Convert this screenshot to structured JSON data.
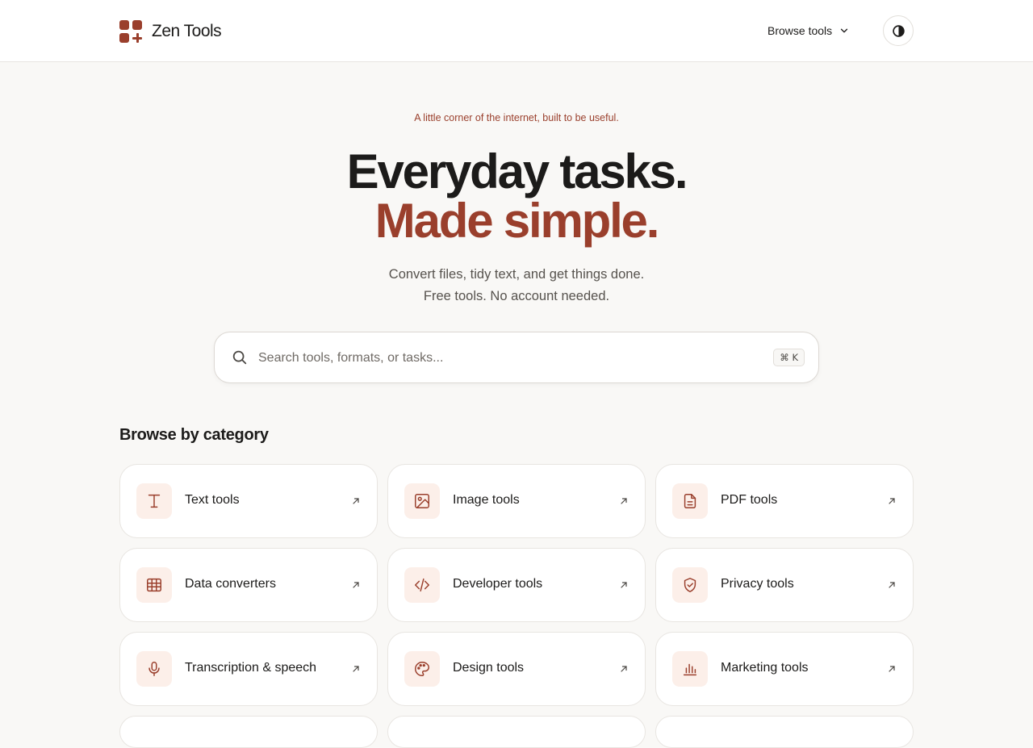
{
  "header": {
    "brand": "Zen Tools",
    "browse_label": "Browse tools",
    "theme_toggle_icon": "contrast-icon"
  },
  "hero": {
    "tagline": "A little corner of the internet, built to be useful.",
    "title_line1": "Everyday tasks.",
    "title_line2": "Made simple.",
    "subtitle_line1": "Convert files, tidy text, and get things done.",
    "subtitle_line2": "Free tools. No account needed."
  },
  "search": {
    "placeholder": "Search tools, formats, or tasks...",
    "shortcut": "⌘ K"
  },
  "categories": {
    "title": "Browse by category",
    "items": [
      {
        "label": "Text tools",
        "icon": "text-icon"
      },
      {
        "label": "Image tools",
        "icon": "image-icon"
      },
      {
        "label": "PDF tools",
        "icon": "document-icon"
      },
      {
        "label": "Data converters",
        "icon": "table-icon"
      },
      {
        "label": "Developer tools",
        "icon": "code-icon"
      },
      {
        "label": "Privacy tools",
        "icon": "shield-check-icon"
      },
      {
        "label": "Transcription & speech",
        "icon": "microphone-icon"
      },
      {
        "label": "Design tools",
        "icon": "palette-icon"
      },
      {
        "label": "Marketing tools",
        "icon": "bar-chart-icon"
      }
    ]
  },
  "colors": {
    "accent": "#9a3f2c",
    "icon_bg": "#fcefe9",
    "page_bg": "#f9f8f6"
  }
}
